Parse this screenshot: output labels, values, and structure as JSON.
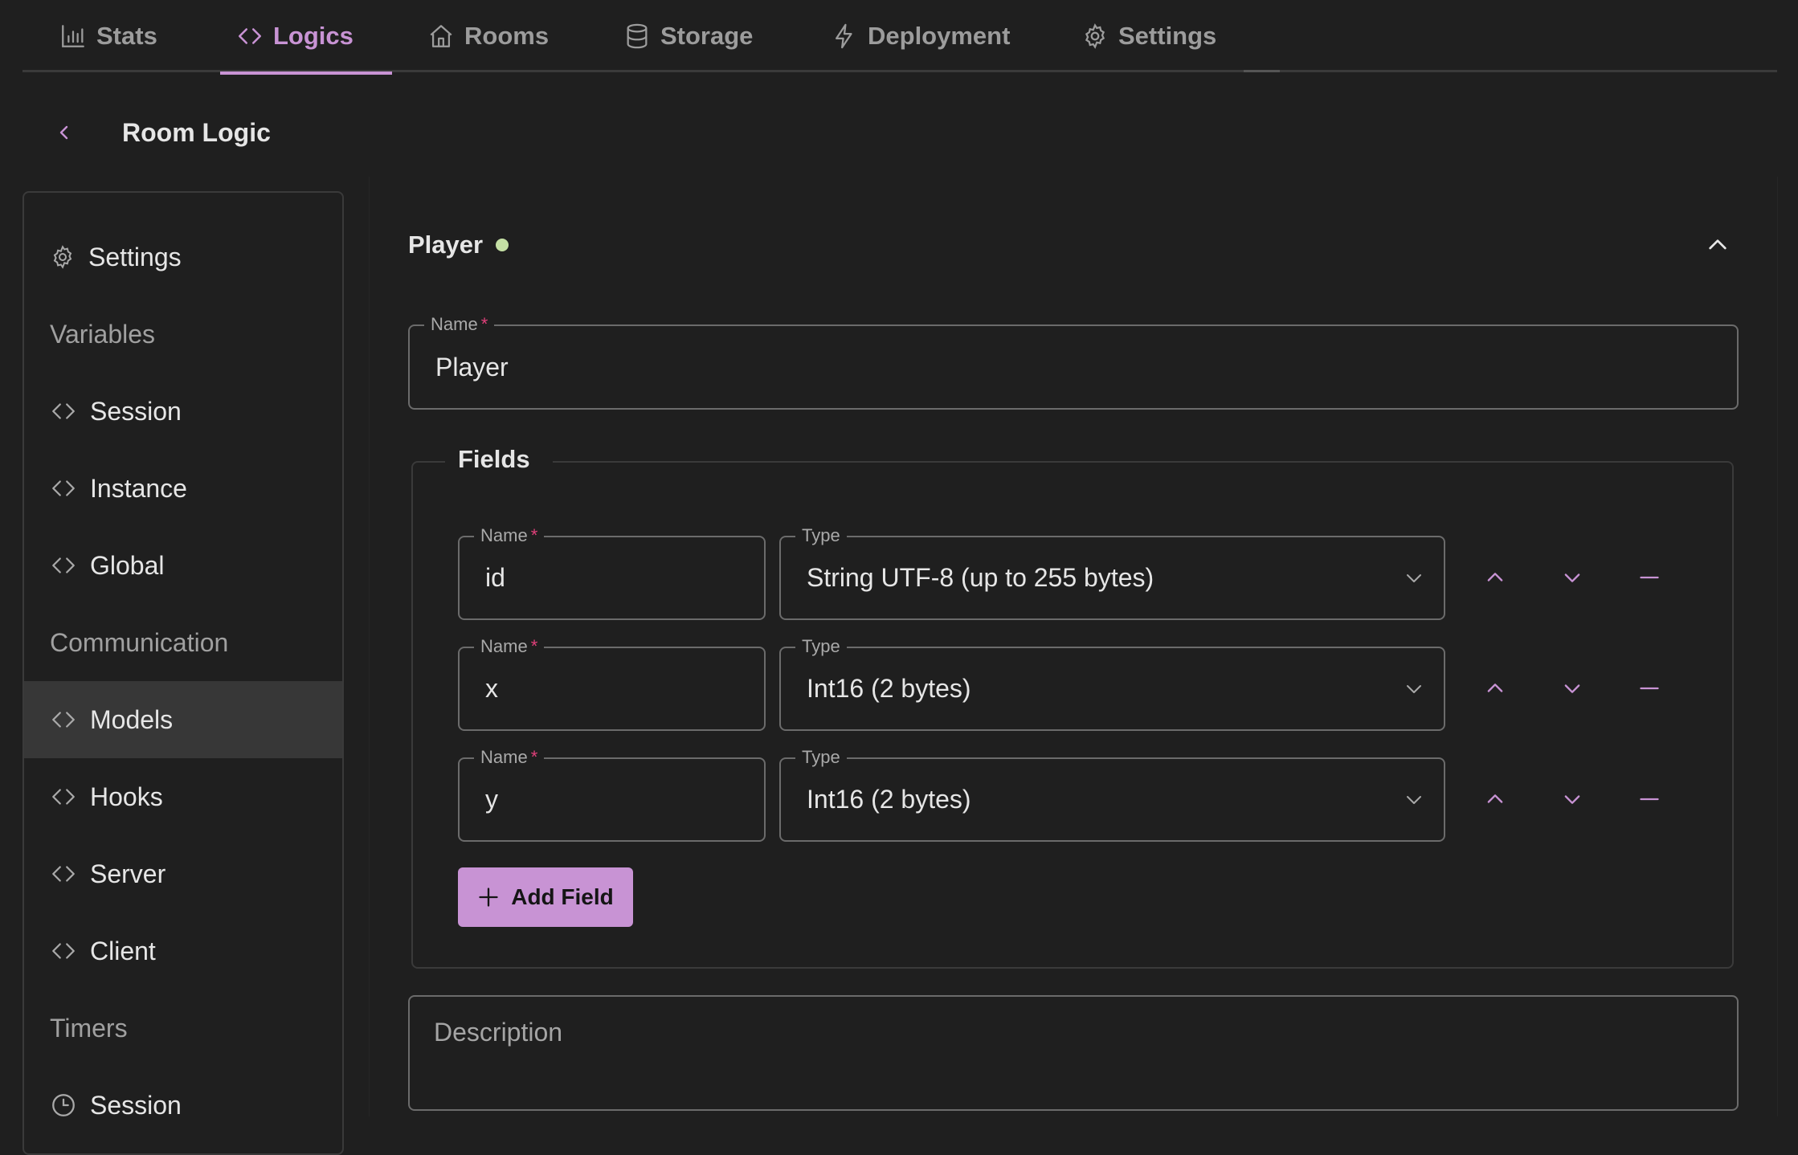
{
  "top_tabs": [
    {
      "label": "Stats",
      "icon": "bar-chart-icon",
      "active": false
    },
    {
      "label": "Logics",
      "icon": "code-icon",
      "active": true
    },
    {
      "label": "Rooms",
      "icon": "home-icon",
      "active": false
    },
    {
      "label": "Storage",
      "icon": "database-icon",
      "active": false
    },
    {
      "label": "Deployment",
      "icon": "lightning-icon",
      "active": false
    },
    {
      "label": "Settings",
      "icon": "gear-icon",
      "active": false
    }
  ],
  "header": {
    "back_icon": "chevron-left-icon",
    "title": "Room Logic"
  },
  "sidebar": {
    "items": [
      {
        "type": "item",
        "label": "Settings",
        "icon": "gear-icon"
      },
      {
        "type": "section",
        "label": "Variables"
      },
      {
        "type": "item",
        "label": "Session",
        "icon": "code-icon"
      },
      {
        "type": "item",
        "label": "Instance",
        "icon": "code-icon"
      },
      {
        "type": "item",
        "label": "Global",
        "icon": "code-icon"
      },
      {
        "type": "section",
        "label": "Communication"
      },
      {
        "type": "item",
        "label": "Models",
        "icon": "code-icon",
        "selected": true
      },
      {
        "type": "item",
        "label": "Hooks",
        "icon": "code-icon"
      },
      {
        "type": "item",
        "label": "Server",
        "icon": "code-icon"
      },
      {
        "type": "item",
        "label": "Client",
        "icon": "code-icon"
      },
      {
        "type": "section",
        "label": "Timers"
      },
      {
        "type": "item",
        "label": "Session",
        "icon": "clock-icon"
      }
    ]
  },
  "model": {
    "title": "Player",
    "status_color": "#c5e0a5",
    "name_field": {
      "label": "Name",
      "required_mark": "*",
      "value": "Player"
    },
    "fields_legend": "Fields",
    "fields": [
      {
        "name_label": "Name",
        "required_mark": "*",
        "name": "id",
        "type_label": "Type",
        "type": "String UTF-8 (up to 255 bytes)"
      },
      {
        "name_label": "Name",
        "required_mark": "*",
        "name": "x",
        "type_label": "Type",
        "type": "Int16 (2 bytes)"
      },
      {
        "name_label": "Name",
        "required_mark": "*",
        "name": "y",
        "type_label": "Type",
        "type": "Int16 (2 bytes)"
      }
    ],
    "add_field_label": "Add Field",
    "description_placeholder": "Description",
    "description_value": ""
  },
  "colors": {
    "accent": "#c893d4",
    "background": "#1f1f1f",
    "selected_bg": "#373737",
    "required": "#e0407a"
  }
}
